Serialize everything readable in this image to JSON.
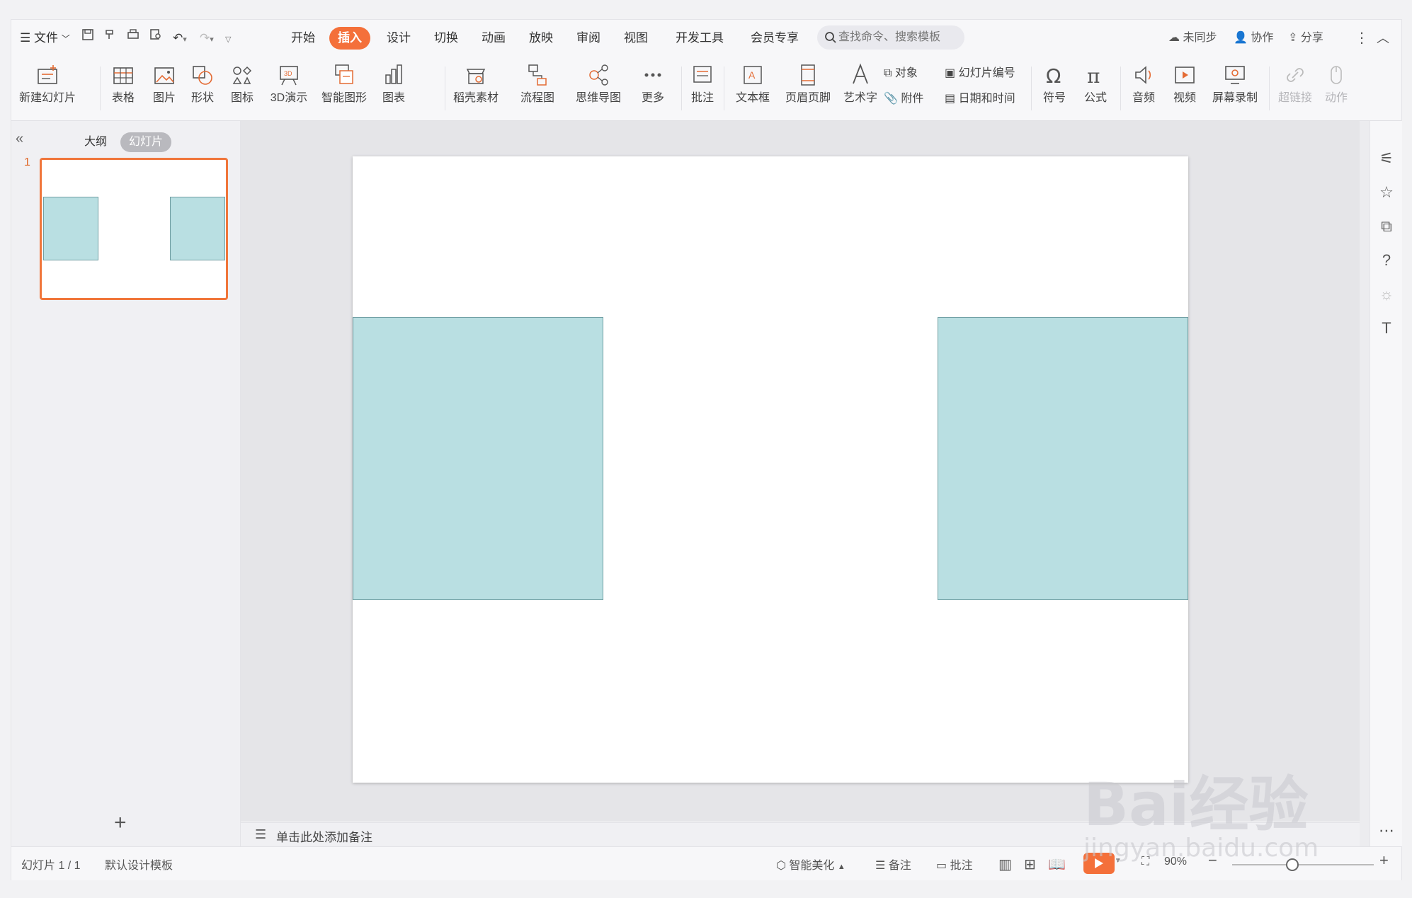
{
  "menubar": {
    "file": "文件",
    "tabs": [
      "开始",
      "插入",
      "设计",
      "切换",
      "动画",
      "放映",
      "审阅",
      "视图",
      "开发工具",
      "会员专享"
    ],
    "active_tab": "插入",
    "search_placeholder": "查找命令、搜索模板",
    "sync": "未同步",
    "collab": "协作",
    "share": "分享"
  },
  "ribbon": {
    "new_slide": "新建幻灯片",
    "table": "表格",
    "picture": "图片",
    "shape": "形状",
    "icon": "图标",
    "3d": "3D演示",
    "smartart": "智能图形",
    "chart": "图表",
    "daoke": "稻壳素材",
    "flowchart": "流程图",
    "mindmap": "思维导图",
    "more": "更多",
    "comment": "批注",
    "textbox": "文本框",
    "header_footer": "页眉页脚",
    "wordart": "艺术字",
    "object": "对象",
    "slide_number": "幻灯片编号",
    "attachment": "附件",
    "datetime": "日期和时间",
    "symbol": "符号",
    "formula": "公式",
    "audio": "音频",
    "video": "视频",
    "screen_record": "屏幕录制",
    "hyperlink": "超链接",
    "animation": "动作"
  },
  "leftpanel": {
    "outline": "大纲",
    "slides": "幻灯片",
    "slide_number": "1"
  },
  "notes": {
    "placeholder": "单击此处添加备注"
  },
  "status": {
    "slide_info": "幻灯片 1 / 1",
    "template": "默认设计模板",
    "beautify": "智能美化",
    "notes": "备注",
    "comment": "批注",
    "zoom": "90%"
  },
  "watermark": {
    "line1": "Bai经验",
    "line2": "jingyan.baidu.com"
  },
  "colors": {
    "accent": "#f4703a",
    "shape_fill": "#b9dfe2",
    "shape_border": "#6f9ea2"
  }
}
